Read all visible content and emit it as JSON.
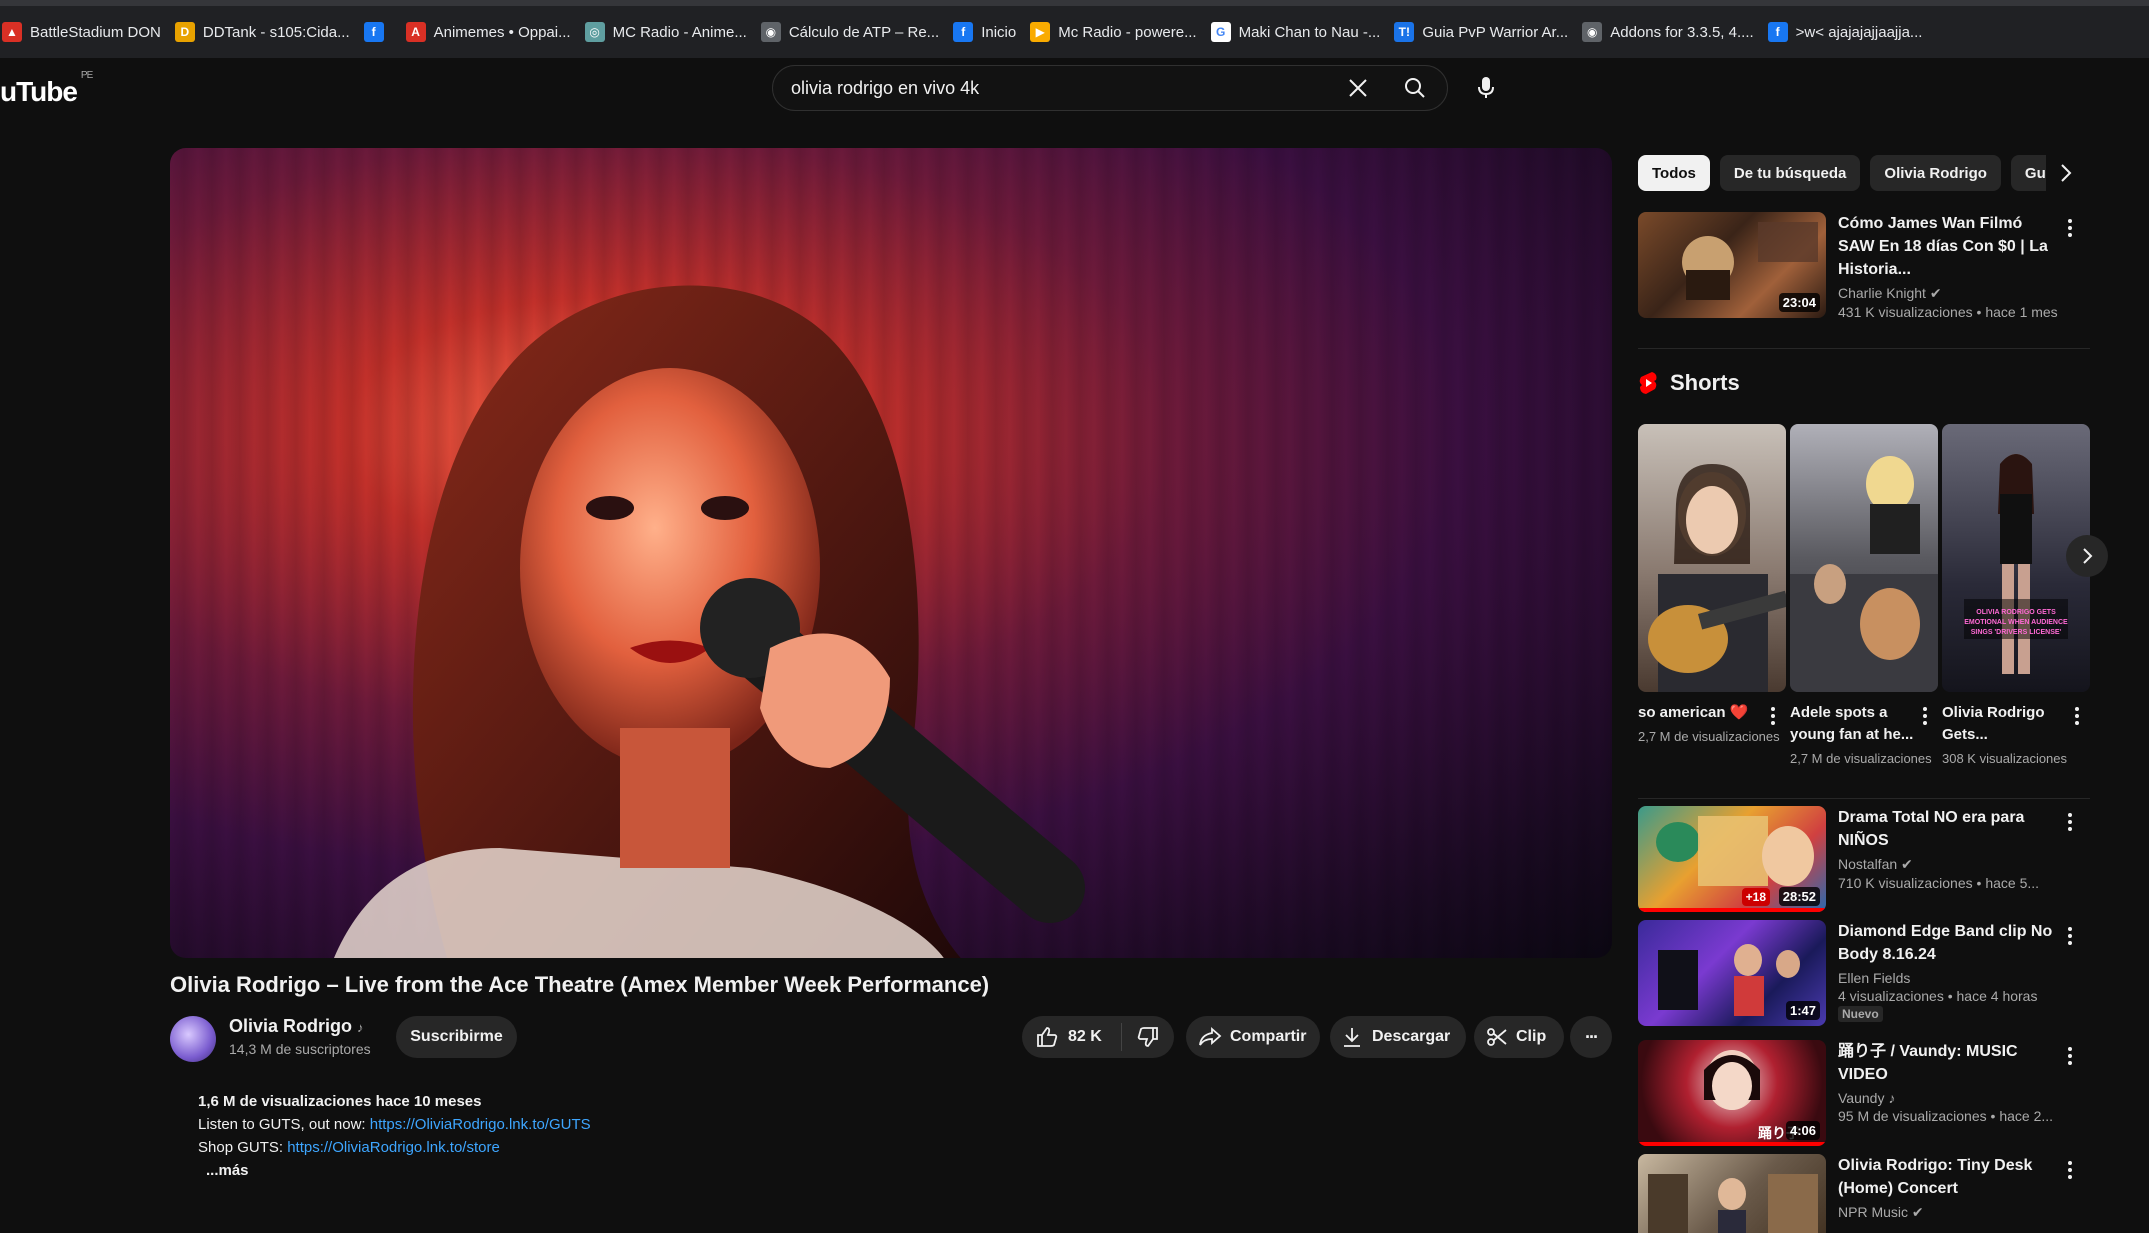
{
  "bookmarks": [
    {
      "label": "BattleStadium DON",
      "color": "#d93025",
      "glyph": "▲"
    },
    {
      "label": "DDTank - s105:Cida...",
      "color": "#e8a200",
      "glyph": "D"
    },
    {
      "label": "",
      "color": "#1877f2",
      "glyph": "f"
    },
    {
      "label": "Animemes • Oppai...",
      "color": "#d93025",
      "glyph": "A"
    },
    {
      "label": "MC Radio - Anime...",
      "color": "#5f9ea0",
      "glyph": "◎"
    },
    {
      "label": "Cálculo de ATP – Re...",
      "color": "#5f6368",
      "glyph": "◉"
    },
    {
      "label": "Inicio",
      "color": "#1877f2",
      "glyph": "f"
    },
    {
      "label": "Mc Radio - powere...",
      "color": "#f9ab00",
      "glyph": "▶"
    },
    {
      "label": "Maki Chan to Nau -...",
      "color": "#ffffff",
      "glyph": "G"
    },
    {
      "label": "Guia PvP Warrior Ar...",
      "color": "#1a73e8",
      "glyph": "T!"
    },
    {
      "label": "Addons for 3.3.5, 4....",
      "color": "#5f6368",
      "glyph": "◉"
    },
    {
      "label": ">w< ajajajajjaajja...",
      "color": "#1877f2",
      "glyph": "f"
    }
  ],
  "header": {
    "logo": "uTube",
    "country": "PE",
    "search_value": "olivia rodrigo  en vivo 4k"
  },
  "video": {
    "title": "Olivia Rodrigo – Live from the Ace Theatre (Amex Member Week Performance)",
    "channel": "Olivia Rodrigo",
    "music_note": "♪",
    "subscribers": "14,3 M de suscriptores",
    "subscribe_label": "Suscribirme",
    "likes": "82 K",
    "share_label": "Compartir",
    "download_label": "Descargar",
    "clip_label": "Clip",
    "more_label": "···"
  },
  "description": {
    "stats": "1,6 M de visualizaciones  hace 10 meses",
    "line1_prefix": "Listen to GUTS, out now: ",
    "line1_link": "https://OliviaRodrigo.lnk.to/GUTS",
    "line2_prefix": "Shop GUTS: ",
    "line2_link": "https://OliviaRodrigo.lnk.to/store",
    "more": "...más"
  },
  "sidebar": {
    "chips": [
      "Todos",
      "De tu búsqueda",
      "Olivia Rodrigo",
      "Gu"
    ],
    "shorts_title": "Shorts",
    "videos": [
      {
        "title": "Cómo James Wan Filmó SAW En 18 días Con $0 | La Historia...",
        "channel": "Charlie Knight",
        "verified": "✔",
        "meta": "431 K visualizaciones  • hace 1 mes",
        "duration": "23:04",
        "new": "",
        "badge": ""
      },
      {
        "title": "Drama Total NO era para NIÑOS",
        "channel": "Nostalfan",
        "verified": "✔",
        "meta": "710 K visualizaciones  • hace 5...",
        "duration": "28:52",
        "new": "",
        "badge": "+18"
      },
      {
        "title": "Diamond Edge Band clip No Body 8.16.24",
        "channel": "Ellen Fields",
        "verified": "",
        "meta": "4 visualizaciones  • hace 4 horas",
        "duration": "1:47",
        "new": "Nuevo",
        "badge": ""
      },
      {
        "title": "踊り子 / Vaundy:  MUSIC VIDEO",
        "channel": "Vaundy",
        "verified": "♪",
        "meta": "95 M de visualizaciones  • hace 2...",
        "duration": "4:06",
        "new": "",
        "badge": ""
      },
      {
        "title": "Olivia Rodrigo: Tiny Desk (Home) Concert",
        "channel": "NPR Music",
        "verified": "✔",
        "meta": "",
        "duration": "",
        "new": "",
        "badge": ""
      }
    ],
    "shorts": [
      {
        "title": "so american ❤️",
        "views": "2,7 M de visualizaciones"
      },
      {
        "title": "Adele spots a young fan at he...",
        "views": "2,7 M de visualizaciones"
      },
      {
        "title": "Olivia Rodrigo Gets...",
        "views": "308 K visualizaciones"
      }
    ]
  },
  "colors": {
    "accent_red": "#ff0000",
    "link_blue": "#3ea6ff",
    "surface": "#272727"
  }
}
